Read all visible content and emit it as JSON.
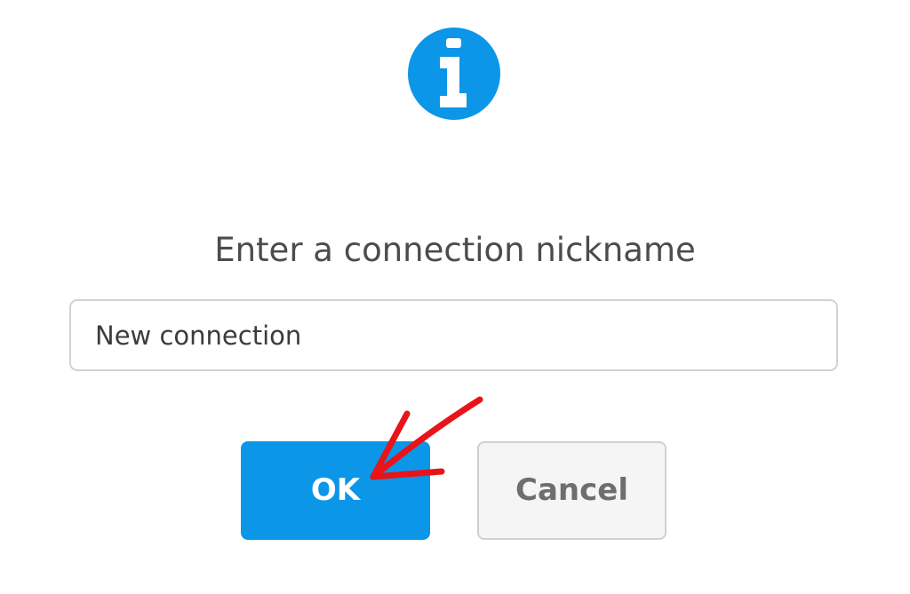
{
  "dialog": {
    "icon": "info-icon",
    "prompt": "Enter a connection nickname",
    "nickname_value": "New connection",
    "ok_label": "OK",
    "cancel_label": "Cancel"
  },
  "colors": {
    "accent": "#0b96e8",
    "annotation": "#e8141a"
  },
  "annotation": {
    "icon": "red-arrow-icon"
  }
}
